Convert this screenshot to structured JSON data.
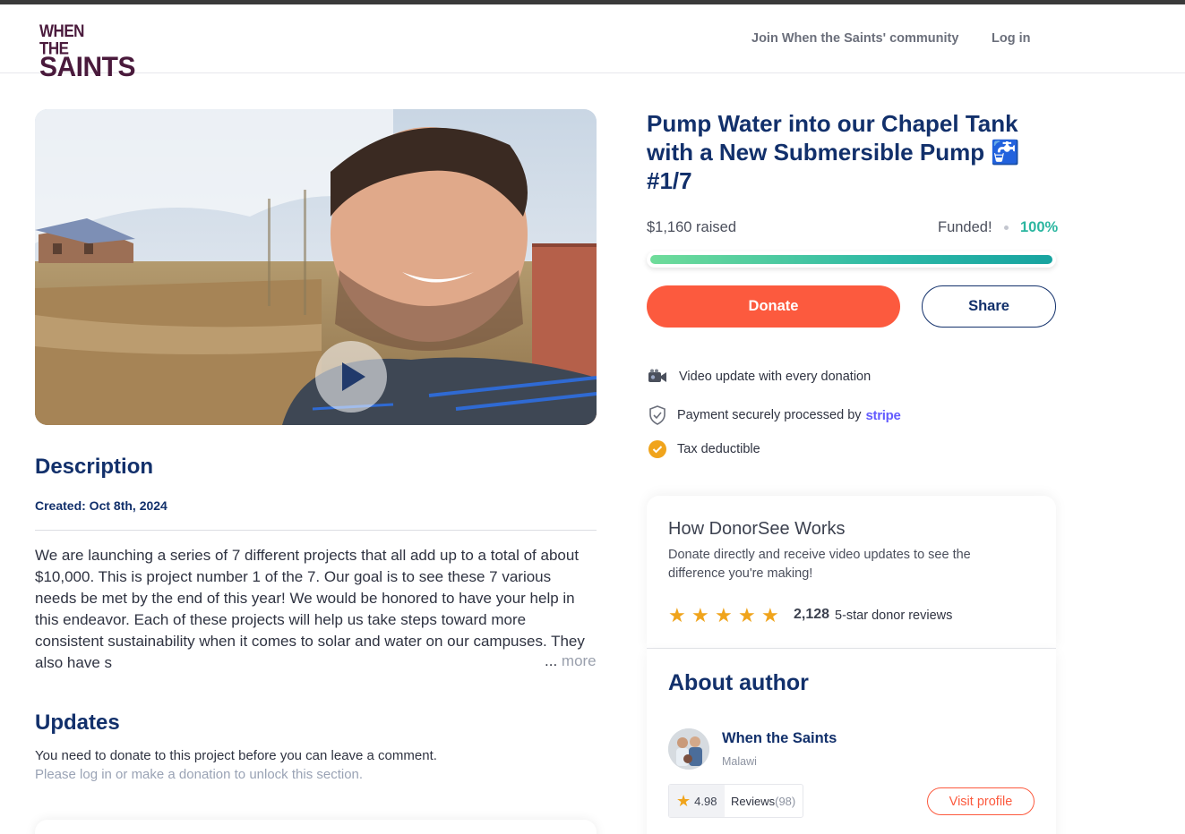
{
  "header": {
    "logo_line1": "WHEN THE",
    "logo_line2": "SAINTS",
    "join_link": "Join When the Saints' community",
    "login_link": "Log in"
  },
  "video": {
    "play_icon": "play-icon"
  },
  "description": {
    "heading": "Description",
    "created": "Created: Oct 8th, 2024",
    "text": "We are launching a series of 7 different projects that all add up to a total of about $10,000. This is project number 1 of the 7. Our goal is to see these 7 various needs be met by the end of this year! We would be honored to have your help in this endeavor. Each of these projects will help us take steps toward more consistent sustainability when it comes to solar and water on our campuses. They also have s",
    "ellipsis": "...",
    "more": "more"
  },
  "updates": {
    "heading": "Updates",
    "notice": "You need to donate to this project before you can leave a comment.",
    "hint": "Please log in or make a donation to unlock this section."
  },
  "project": {
    "title": "Pump Water into our Chapel Tank with a New Submersible Pump 🚰 #1/7",
    "raised": "$1,160 raised",
    "funded": "Funded!",
    "percent": "100%",
    "progress_fraction": 1.0,
    "donate_label": "Donate",
    "share_label": "Share"
  },
  "features": {
    "video_update": "Video update with every donation",
    "payment": "Payment securely processed by",
    "stripe": "stripe",
    "tax": "Tax deductible"
  },
  "how": {
    "title": "How DonorSee Works",
    "subtitle": "Donate directly and receive video updates to see the difference you're making!",
    "star_count": 5,
    "review_count": "2,128",
    "review_text": "5-star donor reviews"
  },
  "author": {
    "heading": "About author",
    "name": "When the Saints",
    "location": "Malawi",
    "rating": "4.98",
    "reviews_label": "Reviews",
    "reviews_count": "(98)",
    "visit_label": "Visit profile"
  },
  "colors": {
    "navy": "#12306b",
    "donate": "#fc5a3e",
    "teal": "#2bb6a0",
    "star": "#f0a41c",
    "stripe": "#635bff"
  }
}
